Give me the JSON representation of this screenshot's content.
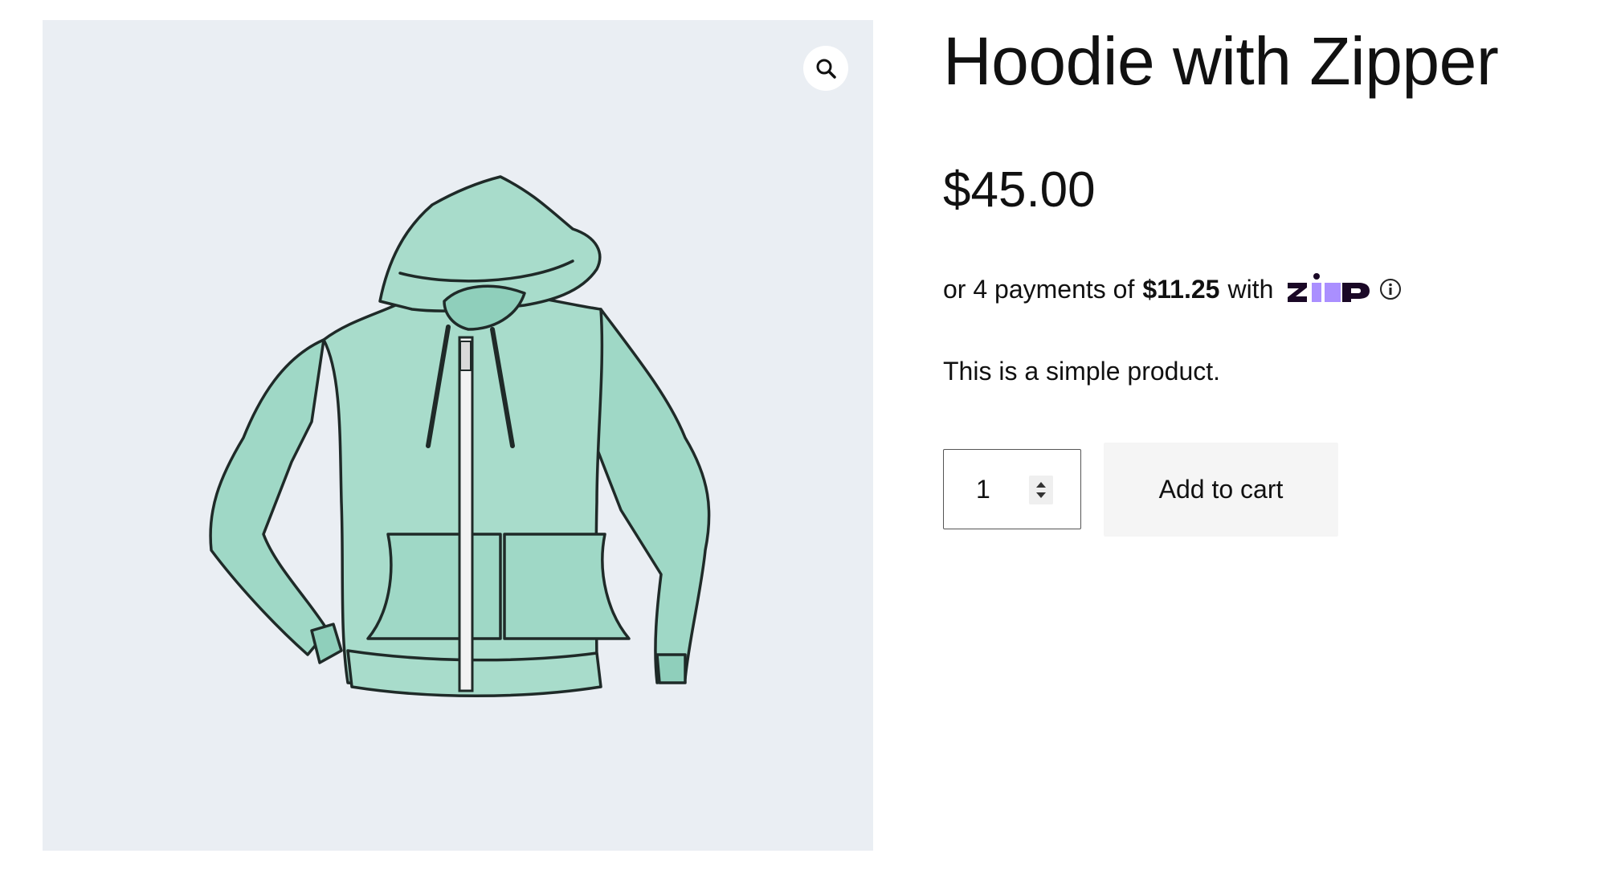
{
  "product": {
    "title": "Hoodie with Zipper",
    "price": "$45.00",
    "description": "This is a simple product.",
    "image_icon": "hoodie-illustration"
  },
  "installments": {
    "prefix": "or 4 payments of",
    "amount": "$11.25",
    "suffix": "with",
    "provider_logo": "zip",
    "info_icon": "info-icon"
  },
  "gallery": {
    "zoom_icon": "magnifier-icon"
  },
  "cart": {
    "quantity": "1",
    "add_label": "Add to cart"
  },
  "colors": {
    "image_background": "#eaeef3",
    "hoodie_fill": "#a8dccb",
    "zip_purple": "#aa8fff",
    "zip_dark": "#1a0826",
    "button_background": "#f5f5f5"
  }
}
